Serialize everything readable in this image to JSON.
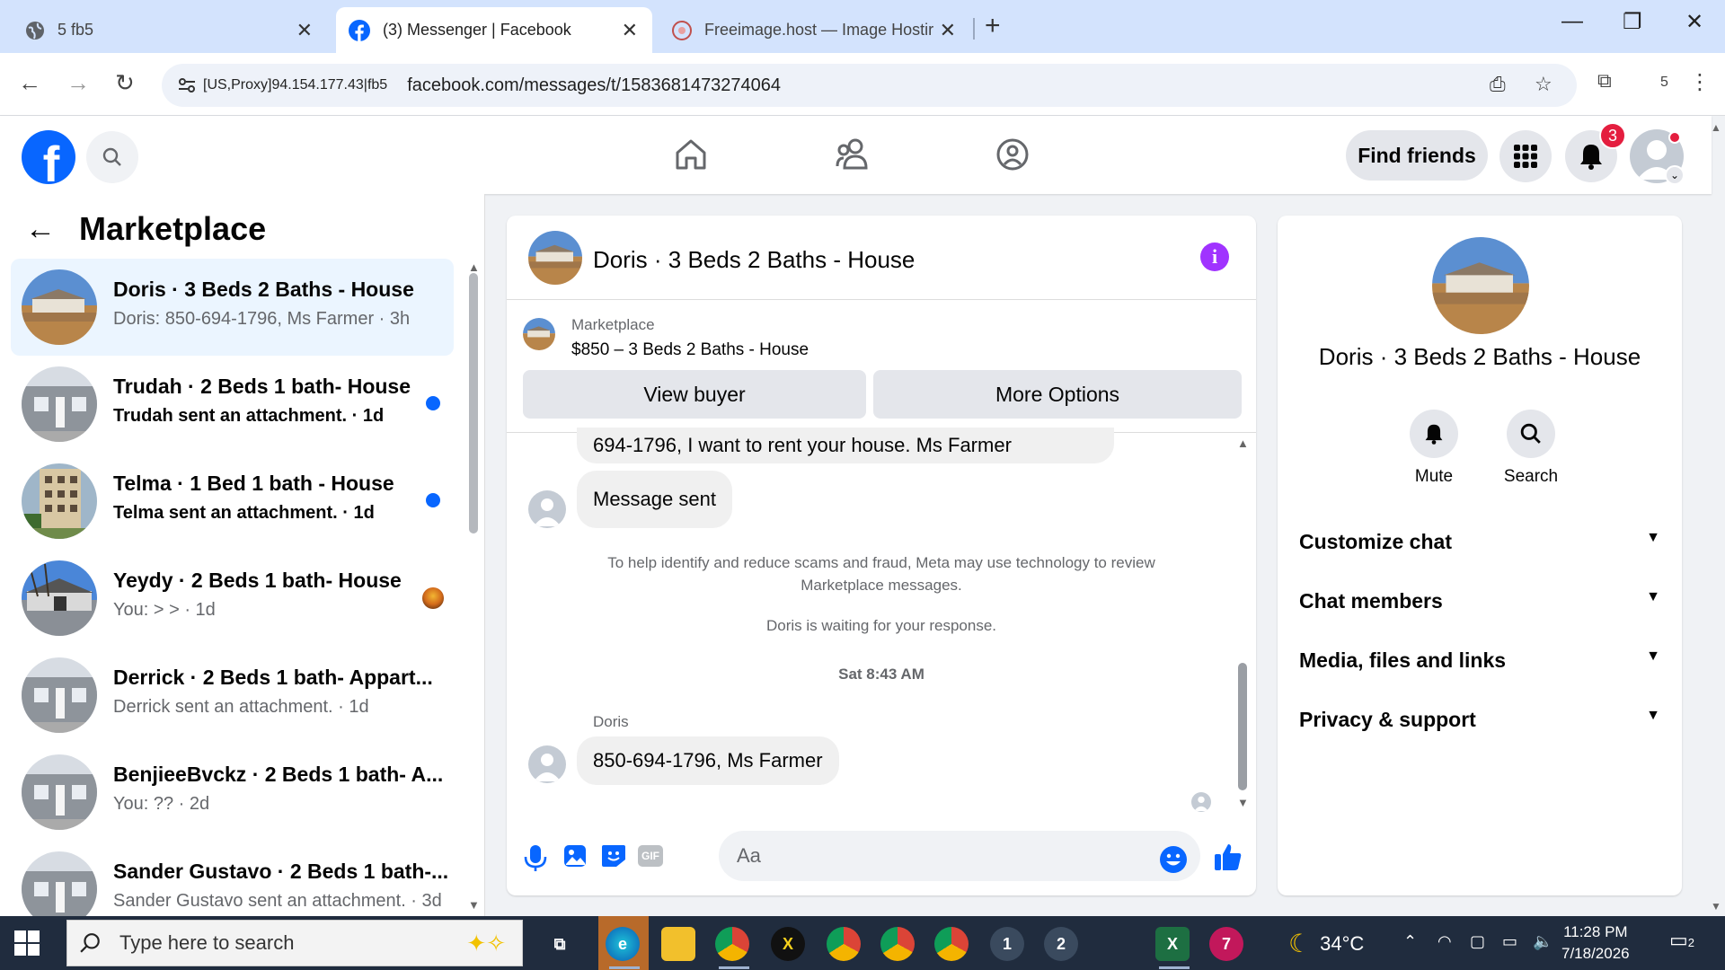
{
  "browser": {
    "tabs": [
      {
        "title": "5 fb5"
      },
      {
        "title": "(3) Messenger | Facebook"
      },
      {
        "title": "Freeimage.host — Image Hostir"
      }
    ],
    "site_info": "[US,Proxy]94.154.177.43|fb5",
    "url": "facebook.com/messages/t/1583681473274064",
    "profile_count": "5"
  },
  "header": {
    "find_friends": "Find friends",
    "notification_count": "3"
  },
  "sidebar": {
    "title": "Marketplace",
    "conversations": [
      {
        "title": "Doris · 3 Beds 2 Baths - House",
        "subtitle": "Doris: 850-694-1796, Ms Farmer · 3h"
      },
      {
        "title": "Trudah · 2 Beds 1 bath- House",
        "subtitle": "Trudah sent an attachment. · 1d"
      },
      {
        "title": "Telma · 1 Bed 1 bath - House",
        "subtitle": "Telma sent an attachment. · 1d"
      },
      {
        "title": "Yeydy · 2 Beds 1 bath- House",
        "subtitle": "You: > > · 1d"
      },
      {
        "title": "Derrick · 2 Beds 1 bath- Appart...",
        "subtitle": "Derrick sent an attachment. · 1d"
      },
      {
        "title": "BenjieeBvckz · 2 Beds 1 bath- A...",
        "subtitle": "You: ?? · 2d"
      },
      {
        "title": "Sander Gustavo · 2 Beds 1 bath-...",
        "subtitle": "Sander Gustavo sent an attachment. · 3d"
      }
    ]
  },
  "chat": {
    "title": "Doris · 3 Beds 2 Baths - House",
    "listing_label": "Marketplace",
    "listing_price": "$850 – 3 Beds 2 Baths - House",
    "view_buyer": "View buyer",
    "more_options": "More Options",
    "msg_partial": "694-1796, I want to rent your house.  Ms Farmer",
    "msg_sent": "Message sent",
    "notice": "To help identify and reduce scams and fraud, Meta may use technology to review Marketplace messages.",
    "waiting": "Doris is waiting for your response.",
    "timestamp": "Sat 8:43 AM",
    "sender": "Doris",
    "last_msg": "850-694-1796, Ms Farmer",
    "input_placeholder": "Aa"
  },
  "right_panel": {
    "name": "Doris · 3 Beds 2 Baths - House",
    "mute": "Mute",
    "search": "Search",
    "sections": [
      "Customize chat",
      "Chat members",
      "Media, files and links",
      "Privacy & support"
    ]
  },
  "taskbar": {
    "search_placeholder": "Type here to search",
    "temperature": "34°C",
    "time": "11:28 PM",
    "date": "7/18/2026",
    "notif_count": "2"
  },
  "colors": {
    "fb_blue": "#0866ff",
    "unread_blue": "#0866ff",
    "info_purple": "#a033ff",
    "badge_red": "#e41e3f"
  }
}
